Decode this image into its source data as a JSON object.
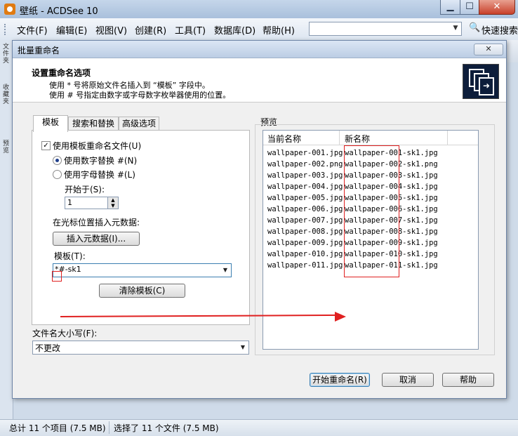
{
  "window": {
    "title": "壁纸 - ACDSee 10",
    "minimize": "▁",
    "maximize": "☐",
    "close": "✕"
  },
  "menu": {
    "items": [
      "文件(F)",
      "编辑(E)",
      "视图(V)",
      "创建(R)",
      "工具(T)",
      "数据库(D)",
      "帮助(H)"
    ],
    "search_value": "",
    "quick_search": "快速搜索"
  },
  "left_strip_labels": [
    "文件夹",
    "收藏夹",
    "预览"
  ],
  "statusbar": {
    "total": "总计 11 个项目 (7.5 MB)",
    "selected": "选择了 11 个文件 (7.5 MB)"
  },
  "dialog": {
    "title": "批量重命名",
    "close": "✕",
    "header": {
      "title": "设置重命名选项",
      "line1": "使用 * 号将原始文件名插入到 “模板” 字段中。",
      "line2": "使用 # 号指定由数字或字母数字枚举器使用的位置。"
    },
    "tabs": [
      "模板",
      "搜索和替换",
      "高级选项"
    ],
    "template_tab": {
      "use_template_checkbox": "使用模板重命名文件(U)",
      "use_template_checked": true,
      "radio_number": "使用数字替换 #(N)",
      "radio_letter": "使用字母替换 #(L)",
      "start_at_label": "开始于(S):",
      "start_at_value": "1",
      "insert_meta_label": "在光标位置插入元数据:",
      "insert_meta_button": "插入元数据(I)...",
      "template_label": "模板(T):",
      "template_value": "*#-sk1",
      "clear_button": "清除模板(C)"
    },
    "case_label": "文件名大小写(F):",
    "case_value": "不更改",
    "preview": {
      "label": "预览",
      "col_current": "当前名称",
      "col_new": "新名称",
      "rows": [
        {
          "current": "wallpaper-001.jpg",
          "new": "wallpaper-001-sk1.jpg"
        },
        {
          "current": "wallpaper-002.png",
          "new": "wallpaper-002-sk1.png"
        },
        {
          "current": "wallpaper-003.jpg",
          "new": "wallpaper-003-sk1.jpg"
        },
        {
          "current": "wallpaper-004.jpg",
          "new": "wallpaper-004-sk1.jpg"
        },
        {
          "current": "wallpaper-005.jpg",
          "new": "wallpaper-005-sk1.jpg"
        },
        {
          "current": "wallpaper-006.jpg",
          "new": "wallpaper-006-sk1.jpg"
        },
        {
          "current": "wallpaper-007.jpg",
          "new": "wallpaper-007-sk1.jpg"
        },
        {
          "current": "wallpaper-008.jpg",
          "new": "wallpaper-008-sk1.jpg"
        },
        {
          "current": "wallpaper-009.jpg",
          "new": "wallpaper-009-sk1.jpg"
        },
        {
          "current": "wallpaper-010.jpg",
          "new": "wallpaper-010-sk1.jpg"
        },
        {
          "current": "wallpaper-011.jpg",
          "new": "wallpaper-011-sk1.jpg"
        }
      ]
    },
    "buttons": {
      "start": "开始重命名(R)",
      "cancel": "取消",
      "help": "帮助"
    }
  },
  "colors": {
    "annotation": "#e02020",
    "header_icon_bg": "#0d1d3a"
  }
}
